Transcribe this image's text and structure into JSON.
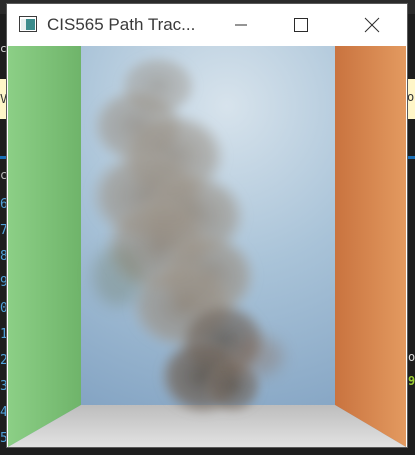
{
  "window": {
    "title": "CIS565 Path Trac...",
    "icon": "app-window-icon",
    "controls": {
      "minimize_icon": "minimize-icon",
      "maximize_icon": "maximize-icon",
      "close_icon": "close-icon"
    }
  },
  "scene": {
    "left_wall_color": "#7fc47a",
    "right_wall_color": "#d98a52",
    "back_wall_color": "#9bb9d2",
    "floor_color": "#cfcfcf",
    "smoke_color": "#8a8177"
  },
  "background": {
    "gutter_numbers": [
      "6",
      "7",
      "8",
      "9",
      "0",
      "1",
      "2",
      "3",
      "4",
      "5"
    ],
    "left_snippets": [
      "c",
      "V"
    ],
    "right_snippets": [
      "o",
      "o",
      "9"
    ]
  }
}
